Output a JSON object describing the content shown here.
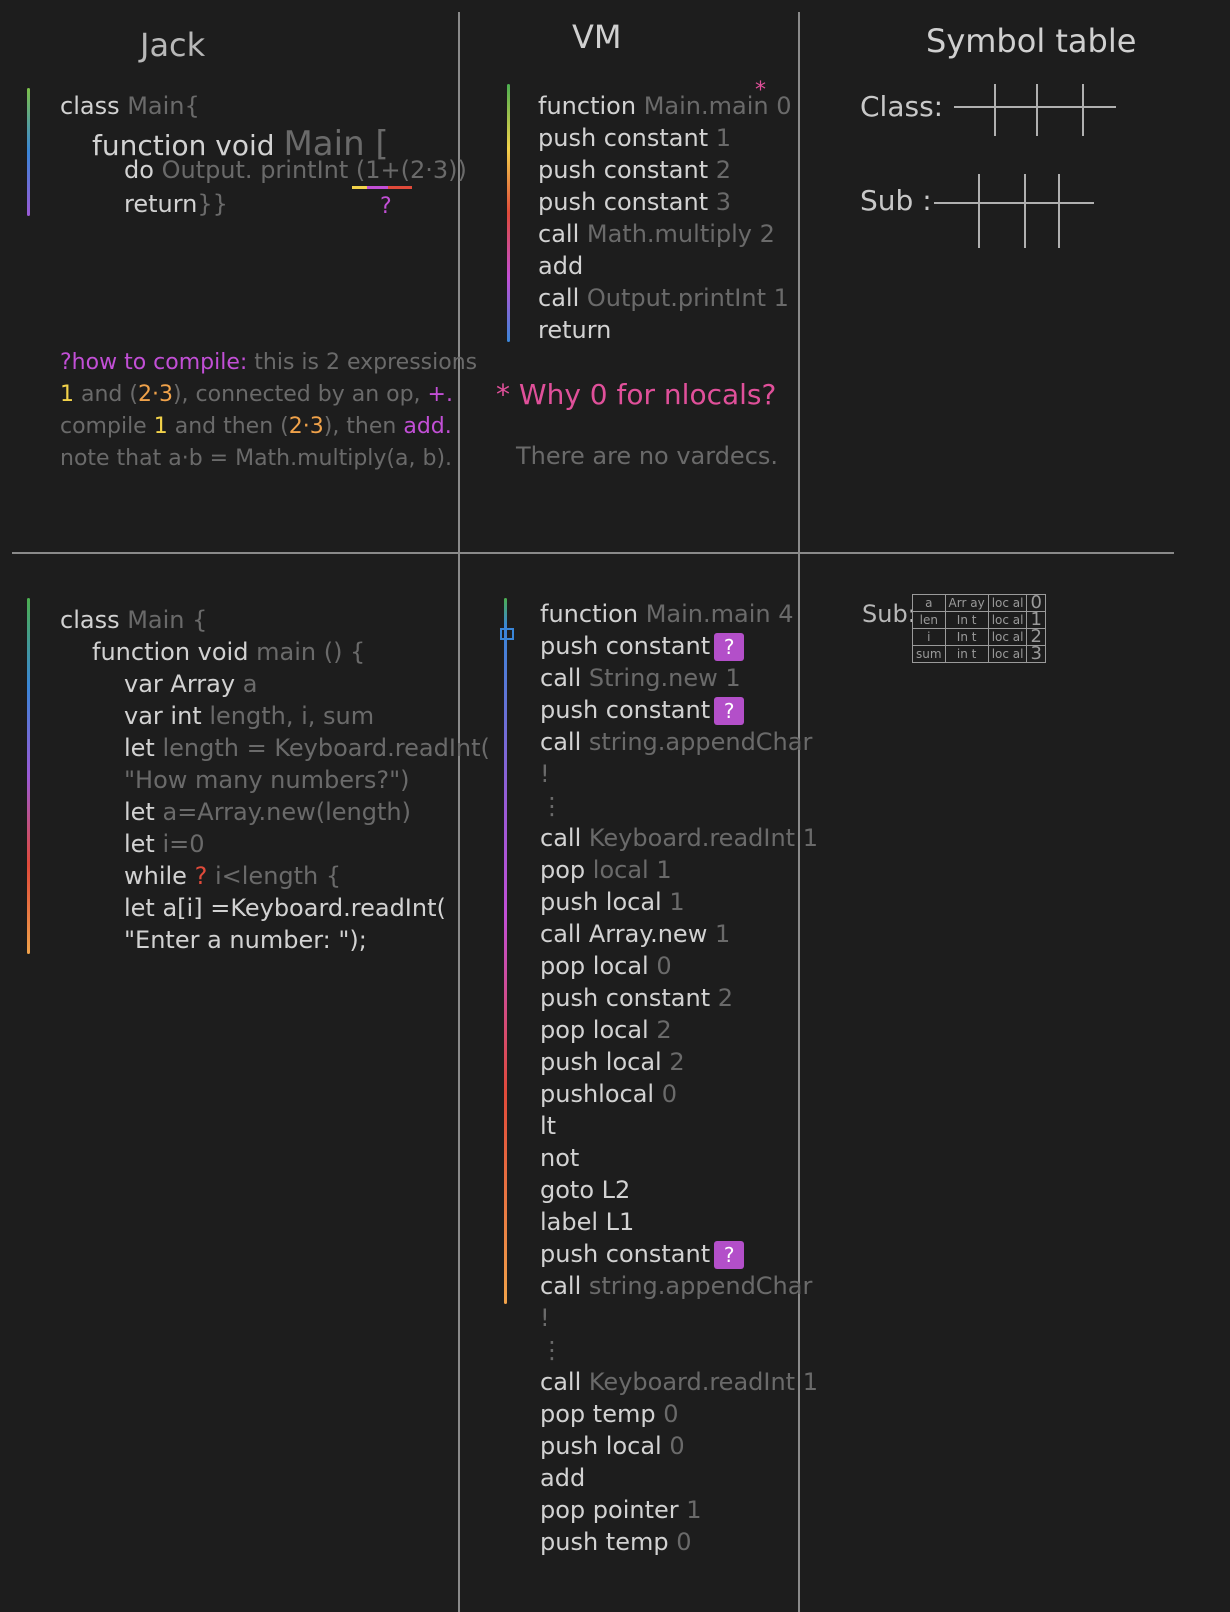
{
  "headers": {
    "jack": "Jack",
    "vm": "VM",
    "symbol_table": "Symbol table"
  },
  "top_jack": {
    "l1_kw": "class",
    "l1_val": "Main{",
    "l2_kw": "function void",
    "l2_val": "Main [",
    "l3_kw": "do",
    "l3_val": "Output. printInt (1+(2·3))",
    "l4_kw": "return",
    "l4_val": "}}",
    "q_mark": "?"
  },
  "note": {
    "q_head": "?how to compile:",
    "l1_rest": "this is 2 expressions",
    "l2_a": "1",
    "l2_b": "and (",
    "l2_c": "2·3",
    "l2_d": "), connected by an op,",
    "l2_e": "+.",
    "l3_a": "compile",
    "l3_b": "1",
    "l3_c": "and then (",
    "l3_d": "2·3",
    "l3_e": "), then",
    "l3_f": "add.",
    "l4": "note that a·b = Math.multiply(a, b)."
  },
  "top_vm": {
    "lines": [
      {
        "kw": "function",
        "val": "Main.main 0"
      },
      {
        "kw": "push constant",
        "val": "1"
      },
      {
        "kw": "push constant",
        "val": "2"
      },
      {
        "kw": "push constant",
        "val": "3"
      },
      {
        "kw": "call",
        "val": "Math.multiply 2"
      },
      {
        "kw": "add",
        "val": ""
      },
      {
        "kw": "call",
        "val": "Output.printInt 1"
      },
      {
        "kw": "return",
        "val": ""
      }
    ],
    "star": "*",
    "question": "* Why 0 for nlocals?",
    "answer": "There are no vardecs."
  },
  "symbol_top": {
    "class_label": "Class:",
    "sub_label": "Sub :"
  },
  "bottom_jack": {
    "lines": [
      {
        "kw": "class",
        "val": "Main {"
      },
      {
        "kw": "function void",
        "val": "main () {"
      },
      {
        "kw": "var Array",
        "val": "a"
      },
      {
        "kw": "var int",
        "val": "length, i, sum"
      },
      {
        "kw": "let",
        "val": "length = Keyboard.readInt("
      },
      {
        "kw": "",
        "val": "\"How many numbers?\")"
      },
      {
        "kw": "let",
        "val": "a=Array.new(length)"
      },
      {
        "kw": "let",
        "val": "i=0"
      },
      {
        "kw": "while",
        "val": "i<length {"
      },
      {
        "kw": "let a[i] =Keyboard.readInt(",
        "val": ""
      },
      {
        "kw": "\"Enter a number: \");",
        "val": ""
      }
    ],
    "q_mark": "?"
  },
  "bottom_vm": {
    "lines": [
      {
        "kw": "function",
        "val": "Main.main 4",
        "q": false
      },
      {
        "kw": "push constant",
        "val": "",
        "q": true
      },
      {
        "kw": "call",
        "val": "String.new 1",
        "q": false
      },
      {
        "kw": "push constant",
        "val": "",
        "q": true
      },
      {
        "kw": "call",
        "val": "string.appendChar",
        "q": false
      },
      {
        "kw": "",
        "val": "!",
        "q": false
      },
      {
        "kw": "",
        "val": "⋮",
        "q": false
      },
      {
        "kw": "call",
        "val": "Keyboard.readInt 1",
        "q": false
      },
      {
        "kw": "pop",
        "val": "local 1",
        "q": false
      },
      {
        "kw": "push local",
        "val": "1",
        "q": false
      },
      {
        "kw": "call Array.new",
        "val": "1",
        "q": false
      },
      {
        "kw": "pop local",
        "val": "0",
        "q": false
      },
      {
        "kw": "push constant",
        "val": "2",
        "q": false
      },
      {
        "kw": "pop local",
        "val": "2",
        "q": false
      },
      {
        "kw": "push local",
        "val": "2",
        "q": false
      },
      {
        "kw": "pushlocal",
        "val": "0",
        "q": false
      },
      {
        "kw": "lt",
        "val": "",
        "q": false
      },
      {
        "kw": "not",
        "val": "",
        "q": false
      },
      {
        "kw": "goto L2",
        "val": "",
        "q": false
      },
      {
        "kw": "label L1",
        "val": "",
        "q": false
      },
      {
        "kw": "push constant",
        "val": "",
        "q": true
      },
      {
        "kw": "call",
        "val": "string.appendChar",
        "q": false
      },
      {
        "kw": "",
        "val": "!",
        "q": false
      },
      {
        "kw": "",
        "val": "⋮",
        "q": false
      },
      {
        "kw": "call",
        "val": "Keyboard.readInt 1",
        "q": false
      },
      {
        "kw": "pop temp",
        "val": "0",
        "q": false
      },
      {
        "kw": "push local",
        "val": "0",
        "q": false
      },
      {
        "kw": "add",
        "val": "",
        "q": false
      },
      {
        "kw": "pop pointer",
        "val": "1",
        "q": false
      },
      {
        "kw": "push temp",
        "val": "0",
        "q": false
      }
    ],
    "q_label": "?"
  },
  "symbol_bottom": {
    "sub_label": "Sub:",
    "rows": [
      [
        "a",
        "Arr ay",
        "loc al",
        "0"
      ],
      [
        "len",
        "In t",
        "loc al",
        "1"
      ],
      [
        "i",
        "In t",
        "loc al",
        "2"
      ],
      [
        "sum",
        "in t",
        "loc al",
        "3"
      ]
    ]
  },
  "colors": {
    "background": "#1d1d1d",
    "divider": "#8a8a8a",
    "keyword": "#d2d2d2",
    "value": "#6a6a6a",
    "magenta": "#c24fd6",
    "pink": "#e0509a",
    "orange": "#f0a24a",
    "red": "#e04a3a",
    "yellow": "#f2d24a"
  }
}
